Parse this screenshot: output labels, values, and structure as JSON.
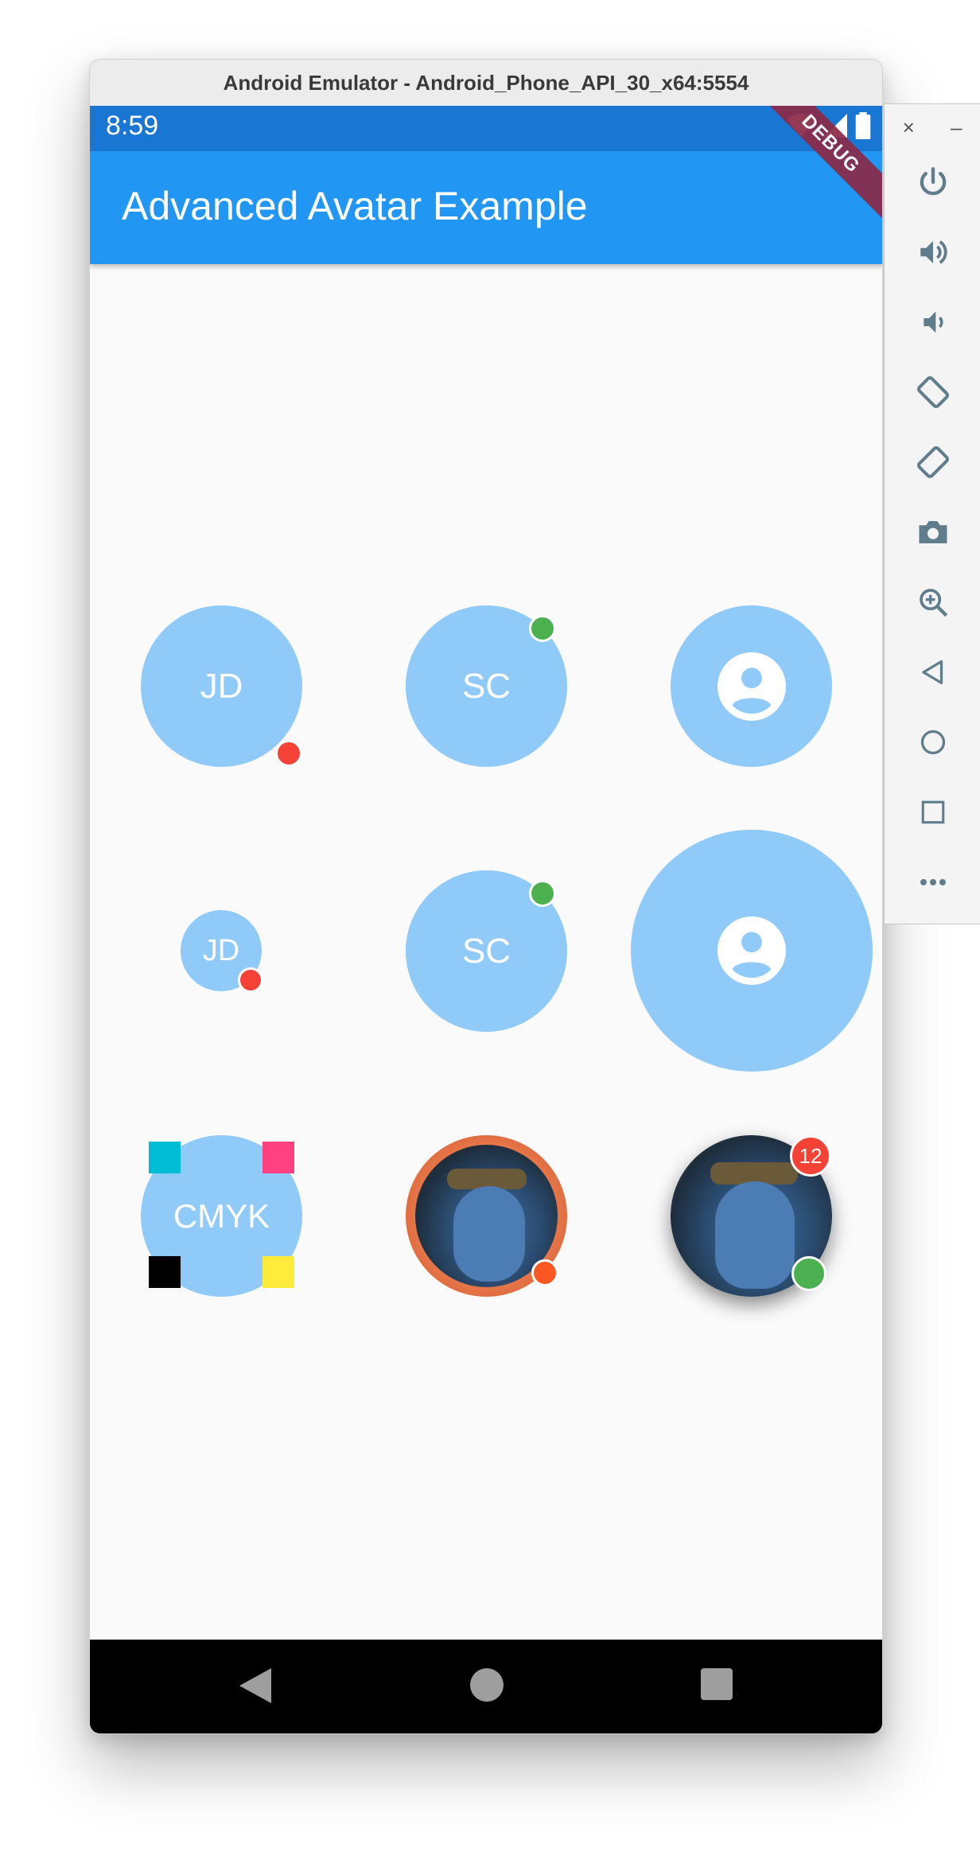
{
  "window": {
    "title": "Android Emulator - Android_Phone_API_30_x64:5554"
  },
  "status_bar": {
    "time": "8:59"
  },
  "debug_banner": "DEBUG",
  "app_bar": {
    "title": "Advanced Avatar Example"
  },
  "avatars": {
    "a1": {
      "initials": "JD",
      "status": "red"
    },
    "a2": {
      "initials": "SC",
      "status": "green"
    },
    "a3": {
      "icon": "account-circle-icon"
    },
    "a4": {
      "initials": "JD",
      "status": "red"
    },
    "a5": {
      "initials": "SC",
      "status": "green"
    },
    "a6": {
      "icon": "account-circle-icon"
    },
    "a7": {
      "initials": "CMYK",
      "corners": [
        "#00BCD4",
        "#FF4081",
        "#000000",
        "#FFEB3B"
      ]
    },
    "a8": {
      "image": "avatar-photo",
      "ring": "#E0602F",
      "status": "#FF5722"
    },
    "a9": {
      "image": "avatar-photo",
      "badge": "12",
      "status": "#4CAF50"
    }
  },
  "colors": {
    "status_bar": "#1976D2",
    "app_bar": "#2196F3",
    "avatar_bg": "#90CAF9",
    "red_dot": "#F44336",
    "green_dot": "#4CAF50"
  },
  "side_toolbar": {
    "items": [
      "close-icon",
      "minimize-icon",
      "power-icon",
      "volume-up-icon",
      "volume-down-icon",
      "rotate-left-icon",
      "rotate-right-icon",
      "camera-icon",
      "zoom-icon",
      "back-icon",
      "home-icon",
      "overview-icon",
      "more-icon"
    ]
  },
  "nav_bar": {
    "items": [
      "back-icon",
      "home-icon",
      "recents-icon"
    ]
  }
}
